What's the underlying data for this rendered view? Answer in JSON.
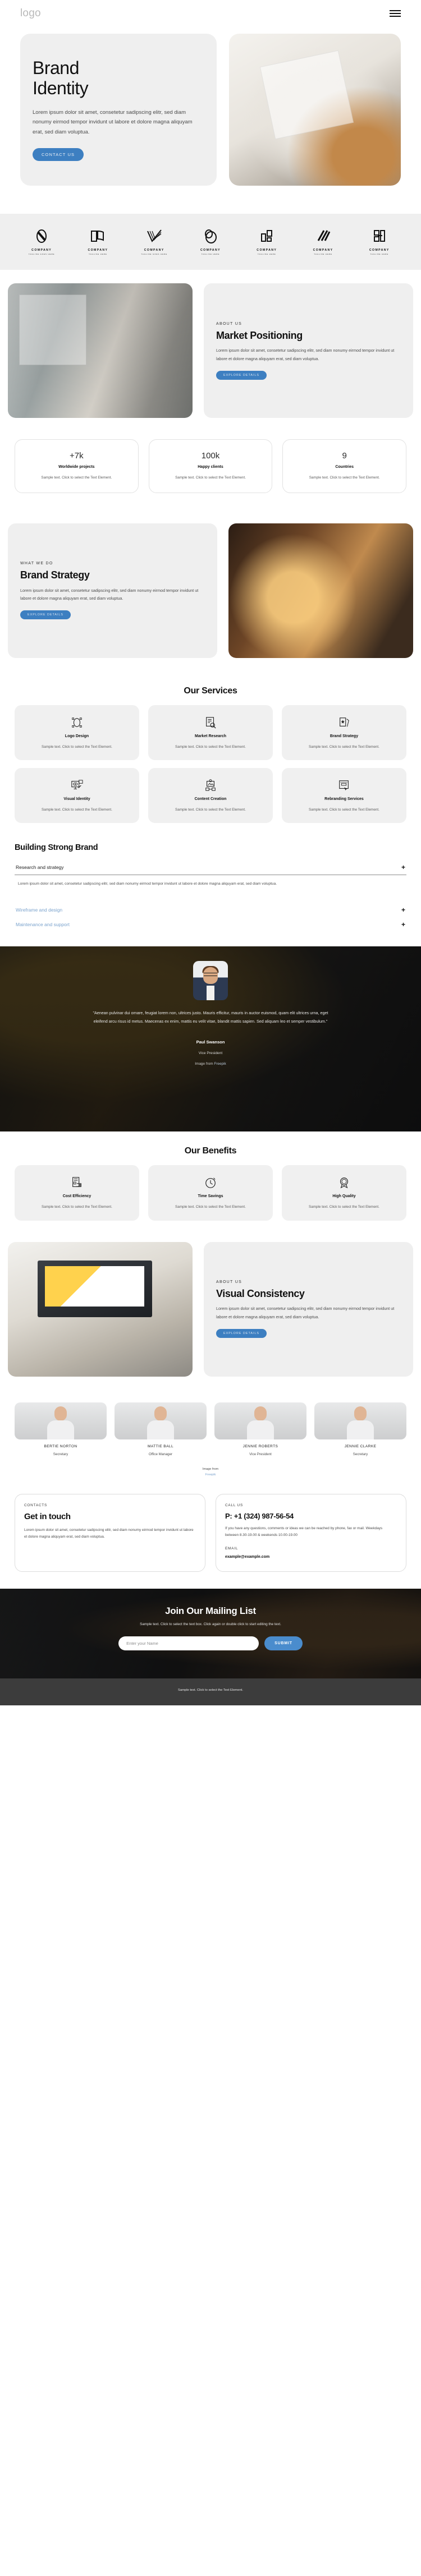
{
  "header": {
    "logo": "logo",
    "menu_icon": "hamburger-icon"
  },
  "hero": {
    "title_line1": "Brand",
    "title_line2": "Identity",
    "text": "Lorem ipsum dolor sit amet, consetetur sadipscing elitr, sed diam nonumy eirmod tempor invidunt ut labore et dolore magna aliquyam erat, sed diam voluptua.",
    "cta": "CONTACT US"
  },
  "logo_strip": [
    {
      "name": "COMPANY",
      "tagline": "TAGLINE GOES HERE"
    },
    {
      "name": "COMPANY",
      "tagline": "TAGLINE HERE"
    },
    {
      "name": "COMPANY",
      "tagline": "TAGLINE GOES HERE"
    },
    {
      "name": "COMPANY",
      "tagline": "TAGLINE HERE"
    },
    {
      "name": "COMPANY",
      "tagline": "TAGLINE HERE"
    },
    {
      "name": "COMPANY",
      "tagline": "TAGLINE HERE"
    },
    {
      "name": "COMPANY",
      "tagline": "TAGLINE HERE"
    }
  ],
  "market": {
    "eyebrow": "ABOUT US",
    "title": "Market Positioning",
    "text": "Lorem ipsum dolor sit amet, consetetur sadipscing elitr, sed diam nonumy eirmod tempor invidunt ut labore et dolore magna aliquyam erat, sed diam voluptua.",
    "cta": "EXPLORE DETAILS"
  },
  "stats": [
    {
      "number": "+7k",
      "label": "Worldwide projects",
      "text": "Sample text. Click to select the Text Element."
    },
    {
      "number": "100k",
      "label": "Happy clients",
      "text": "Sample text. Click to select the Text Element."
    },
    {
      "number": "9",
      "label": "Countries",
      "text": "Sample text. Click to select the Text Element."
    }
  ],
  "strategy": {
    "eyebrow": "WHAT WE DO",
    "title": "Brand Strategy",
    "text": "Lorem ipsum dolor sit amet, consetetur sadipscing elitr, sed diam nonumy eirmod tempor invidunt ut labore et dolore magna aliquyam erat, sed diam voluptua.",
    "cta": "EXPLORE DETAILS"
  },
  "services": {
    "title": "Our Services",
    "items": [
      {
        "icon": "logo-design-icon",
        "title": "Logo Design",
        "text": "Sample text. Click to select the Text Element."
      },
      {
        "icon": "market-research-icon",
        "title": "Market Research",
        "text": "Sample text. Click to select the Text Element."
      },
      {
        "icon": "brand-strategy-icon",
        "title": "Brand Strategy",
        "text": "Sample text. Click to select the Text Element."
      },
      {
        "icon": "visual-identity-icon",
        "title": "Visual Identity",
        "text": "Sample text. Click to select the Text Element."
      },
      {
        "icon": "content-creation-icon",
        "title": "Content Creation",
        "text": "Sample text. Click to select the Text Element."
      },
      {
        "icon": "rebranding-icon",
        "title": "Rebranding Services",
        "text": "Sample text. Click to select the Text Element."
      }
    ]
  },
  "accordion": {
    "title": "Building Strong Brand",
    "items": [
      {
        "label": "Research and strategy",
        "state": "open",
        "toggle": "+",
        "body": "Lorem ipsum dolor sit amet, consetetur sadipscing elitr, sed diam nonumy eirmod tempor invidunt ut labore et dolore magna aliquyam erat, sed diam voluptua."
      },
      {
        "label": "Wireframe and design",
        "state": "closed",
        "toggle": "+",
        "body": ""
      },
      {
        "label": "Maintenance and support",
        "state": "closed",
        "toggle": "+",
        "body": ""
      }
    ]
  },
  "testimonial": {
    "quote": "\"Aenean pulvinar dui ornare, feugiat lorem non, ultrices justo. Mauris efficitur, mauris in auctor euismod, quam elit ultrices urna, eget eleifend arcu risus id metus. Maecenas ex enim, mattis eu velit vitae, blandit mattis sapien. Sed aliquam leo et semper vestibulum.\"",
    "name": "Paul Swanson",
    "role": "Vice President",
    "credit_prefix": "Image from ",
    "credit_link": "Freepik"
  },
  "benefits": {
    "title": "Our Benefits",
    "items": [
      {
        "icon": "cost-efficiency-icon",
        "title": "Cost Efficiency",
        "text": "Sample text. Click to select the Text Element."
      },
      {
        "icon": "time-savings-icon",
        "title": "Time Savings",
        "text": "Sample text. Click to select the Text Element."
      },
      {
        "icon": "high-quality-icon",
        "title": "High Quality",
        "text": "Sample text. Click to select the Text Element."
      }
    ]
  },
  "visual": {
    "eyebrow": "ABOUT US",
    "title": "Visual Consistency",
    "text": "Lorem ipsum dolor sit amet, consetetur sadipscing elitr, sed diam nonumy eirmod tempor invidunt ut labore et dolore magna aliquyam erat, sed diam voluptua.",
    "cta": "EXPLORE DETAILS"
  },
  "team": {
    "members": [
      {
        "name": "BERTIE NORTON",
        "role": "Secretary"
      },
      {
        "name": "MATTIE BALL",
        "role": "Office Manager"
      },
      {
        "name": "JENNIE ROBERTS",
        "role": "Vice President"
      },
      {
        "name": "JENNIE CLARKE",
        "role": "Secretary"
      }
    ],
    "credit_prefix": "Image from",
    "credit_link": "Freepik"
  },
  "contact": {
    "left": {
      "eyebrow": "CONTACTS",
      "title": "Get in touch",
      "text": "Lorem ipsum dolor sit amet, consetetur sadipscing elitr, sed diam nonumy eirmod tempor invidunt ut labore et dolore magna aliquyam erat, sed diam voluptua."
    },
    "right": {
      "eyebrow": "CALL US",
      "phone": "P: +1 (324) 987-56-54",
      "text": "If you have any questions, comments or ideas we can be reached by phone, fax or mail. Weekdays between 8.30-19.00 & weekends 10.00-19.00",
      "email_label": "EMAIL",
      "email": "example@example.com"
    }
  },
  "mailing": {
    "title": "Join Our Mailing List",
    "subtitle": "Sample text. Click to select the text box. Click again or double click to start editing the text.",
    "input_placeholder": "Enter your Name",
    "input_value": "",
    "submit": "SUBMIT"
  },
  "footer": {
    "text": "Sample text. Click to select the Text Element."
  },
  "colors": {
    "accent": "#3d7fc1",
    "accent_bright": "#4a8ccd",
    "panel": "#efefef",
    "card": "#f0f0f0",
    "footer_bg": "#3c3c3c",
    "muted_link": "#7ba3cd"
  }
}
